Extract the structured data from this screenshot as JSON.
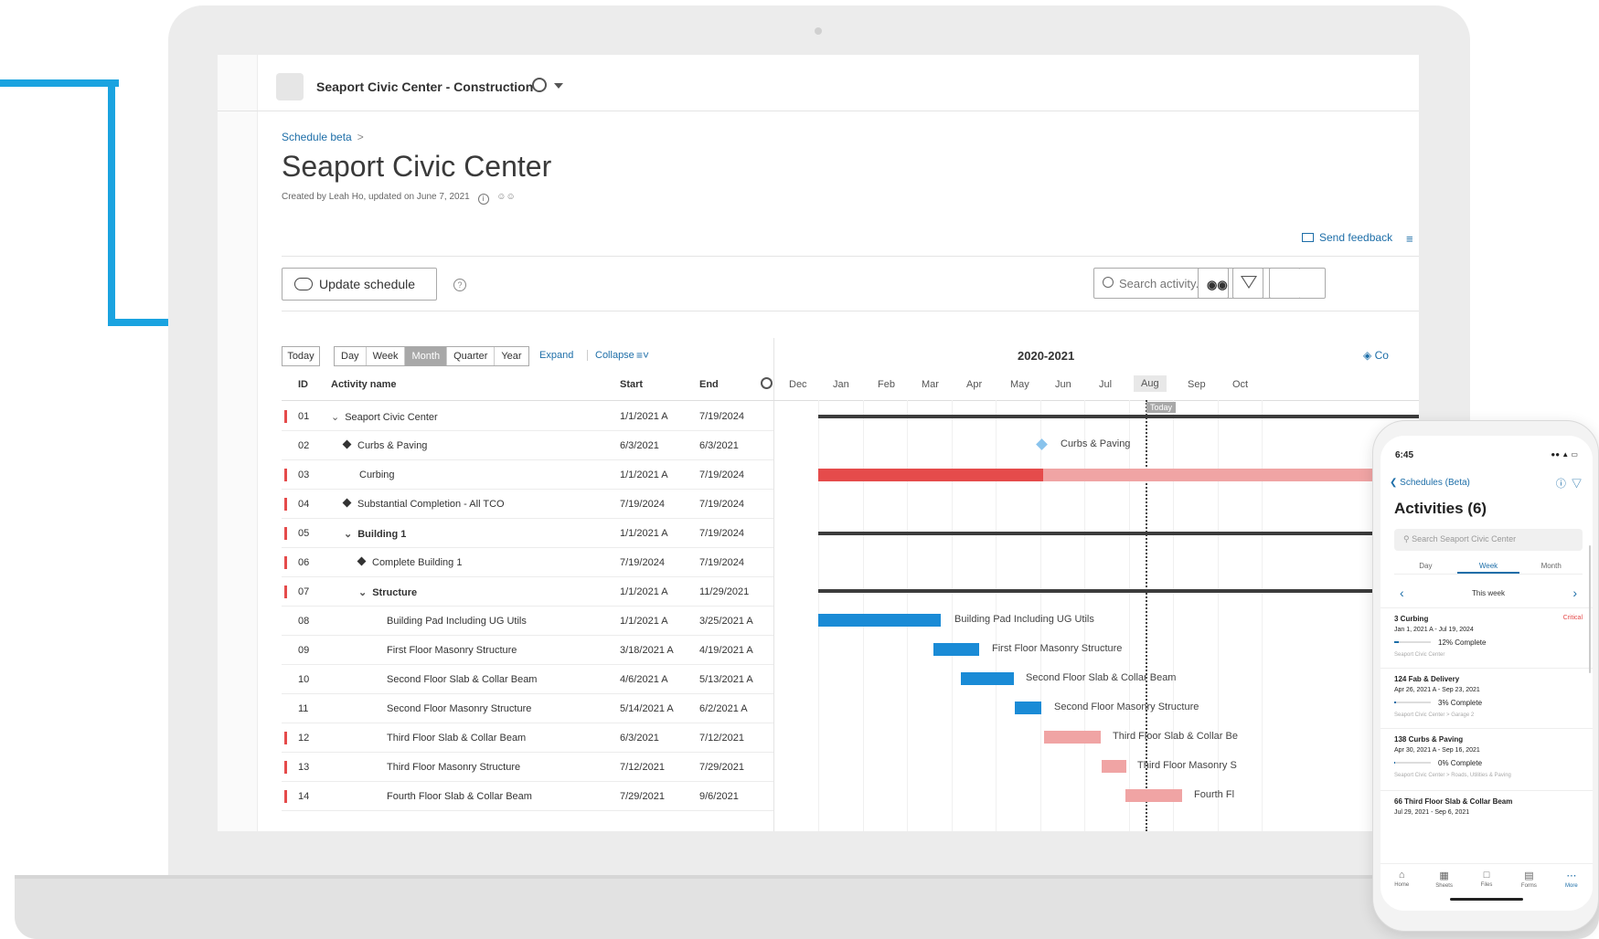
{
  "header": {
    "project_name": "Seaport Civic Center - Construction"
  },
  "page": {
    "breadcrumb": "Schedule beta",
    "breadcrumb_sep": ">",
    "title": "Seaport Civic Center",
    "meta": "Created by Leah Ho, updated on June 7, 2021",
    "send_feedback": "Send feedback"
  },
  "toolbar": {
    "update_schedule": "Update schedule",
    "search_placeholder": "Search activity...",
    "today": "Today",
    "scales": [
      "Day",
      "Week",
      "Month",
      "Quarter",
      "Year"
    ],
    "active_scale": "Month",
    "expand": "Expand",
    "collapse": "Collapse",
    "year_range": "2020-2021",
    "layers_label": "Co"
  },
  "table": {
    "columns": {
      "id": "ID",
      "name": "Activity name",
      "start": "Start",
      "end": "End"
    },
    "rows": [
      {
        "id": "01",
        "name": "Seaport Civic Center",
        "start": "1/1/2021 A",
        "end": "7/19/2024",
        "critical": true,
        "level": 0,
        "type": "group"
      },
      {
        "id": "02",
        "name": "Curbs & Paving",
        "start": "6/3/2021",
        "end": "6/3/2021",
        "critical": false,
        "level": 1,
        "type": "milestone"
      },
      {
        "id": "03",
        "name": "Curbing",
        "start": "1/1/2021 A",
        "end": "7/19/2024",
        "critical": true,
        "level": 1,
        "type": "task"
      },
      {
        "id": "04",
        "name": "Substantial Completion - All TCO",
        "start": "7/19/2024",
        "end": "7/19/2024",
        "critical": true,
        "level": 1,
        "type": "milestone"
      },
      {
        "id": "05",
        "name": "Building 1",
        "start": "1/1/2021 A",
        "end": "7/19/2024",
        "critical": true,
        "level": 1,
        "type": "group"
      },
      {
        "id": "06",
        "name": "Complete Building 1",
        "start": "7/19/2024",
        "end": "7/19/2024",
        "critical": true,
        "level": 2,
        "type": "milestone"
      },
      {
        "id": "07",
        "name": "Structure",
        "start": "1/1/2021 A",
        "end": "11/29/2021",
        "critical": true,
        "level": 2,
        "type": "group"
      },
      {
        "id": "08",
        "name": "Building Pad Including UG Utils",
        "start": "1/1/2021 A",
        "end": "3/25/2021 A",
        "critical": false,
        "level": 3,
        "type": "task"
      },
      {
        "id": "09",
        "name": "First Floor Masonry Structure",
        "start": "3/18/2021 A",
        "end": "4/19/2021 A",
        "critical": false,
        "level": 3,
        "type": "task"
      },
      {
        "id": "10",
        "name": "Second Floor Slab & Collar Beam",
        "start": "4/6/2021 A",
        "end": "5/13/2021 A",
        "critical": false,
        "level": 3,
        "type": "task"
      },
      {
        "id": "11",
        "name": "Second Floor Masonry Structure",
        "start": "5/14/2021 A",
        "end": "6/2/2021 A",
        "critical": false,
        "level": 3,
        "type": "task"
      },
      {
        "id": "12",
        "name": "Third Floor Slab & Collar Beam",
        "start": "6/3/2021",
        "end": "7/12/2021",
        "critical": true,
        "level": 3,
        "type": "task"
      },
      {
        "id": "13",
        "name": "Third Floor Masonry Structure",
        "start": "7/12/2021",
        "end": "7/29/2021",
        "critical": true,
        "level": 3,
        "type": "task"
      },
      {
        "id": "14",
        "name": "Fourth Floor Slab & Collar Beam",
        "start": "7/29/2021",
        "end": "9/6/2021",
        "critical": true,
        "level": 3,
        "type": "task"
      }
    ]
  },
  "gantt": {
    "months": [
      "Dec",
      "Jan",
      "Feb",
      "Mar",
      "Apr",
      "May",
      "Jun",
      "Jul",
      "Aug",
      "Sep",
      "Oct"
    ],
    "current_month": "Aug",
    "today_label": "Today",
    "bar_labels": {
      "curbs": "Curbs & Paving",
      "b08": "Building Pad Including UG Utils",
      "b09": "First Floor Masonry Structure",
      "b10": "Second Floor Slab & Collar Beam",
      "b11": "Second Floor Masonry Structure",
      "b12": "Third Floor Slab & Collar Be",
      "b13": "Third Floor Masonry S",
      "b14": "Fourth Fl"
    },
    "colors": {
      "done": "#1a8bd6",
      "critical": "#e54b4b",
      "critical_light": "#f0a4a4",
      "summary": "#3c3c3c",
      "milestone": "#89c3ec"
    }
  },
  "phone": {
    "time": "6:45",
    "back_label": "Schedules (Beta)",
    "title": "Activities (6)",
    "search_placeholder": "Search Seaport Civic Center",
    "tabs": [
      "Day",
      "Week",
      "Month"
    ],
    "active_tab": "Week",
    "period": "This week",
    "items": [
      {
        "title": "3 Curbing",
        "critical": "Critical",
        "dates": "Jan 1, 2021 A - Jul 19, 2024",
        "progress": "12% Complete",
        "percent": 12,
        "location": "Seaport Civic Center"
      },
      {
        "title": "124 Fab & Delivery",
        "critical": "",
        "dates": "Apr 26, 2021 A - Sep 23, 2021",
        "progress": "3% Complete",
        "percent": 3,
        "location": "Seaport Civic Center > Garage 2"
      },
      {
        "title": "138 Curbs & Paving",
        "critical": "",
        "dates": "Apr 30, 2021 A - Sep 16, 2021",
        "progress": "0% Complete",
        "percent": 0,
        "location": "Seaport Civic Center > Roads, Utilities & Paving"
      },
      {
        "title": "66 Third Floor Slab & Collar Beam",
        "critical": "",
        "dates": "Jul 29, 2021 - Sep 6, 2021",
        "progress": "",
        "percent": 0,
        "location": ""
      }
    ],
    "tabbar": [
      "Home",
      "Sheets",
      "Files",
      "Forms",
      "More"
    ],
    "active_tabbar": "More"
  }
}
